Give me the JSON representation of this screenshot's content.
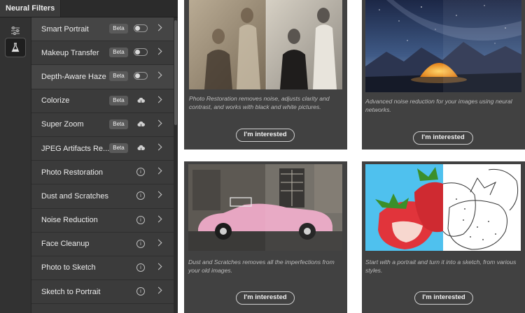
{
  "panel": {
    "title": "Neural Filters",
    "rail": [
      {
        "icon": "sliders-icon"
      },
      {
        "icon": "flask-icon"
      }
    ],
    "filters": [
      {
        "label": "Smart Portrait",
        "badge": "Beta",
        "control": "toggle",
        "selected": true
      },
      {
        "label": "Makeup Transfer",
        "badge": "Beta",
        "control": "toggle",
        "selected": false
      },
      {
        "label": "Depth-Aware Haze",
        "badge": "Beta",
        "control": "toggle",
        "selected": true
      },
      {
        "label": "Colorize",
        "badge": "Beta",
        "control": "cloud-download-icon",
        "selected": false
      },
      {
        "label": "Super Zoom",
        "badge": "Beta",
        "control": "cloud-download-icon",
        "selected": false
      },
      {
        "label": "JPEG Artifacts Re...",
        "badge": "Beta",
        "control": "cloud-download-icon",
        "selected": false
      },
      {
        "label": "Photo Restoration",
        "badge": "",
        "control": "info-icon",
        "selected": false
      },
      {
        "label": "Dust and Scratches",
        "badge": "",
        "control": "info-icon",
        "selected": false
      },
      {
        "label": "Noise Reduction",
        "badge": "",
        "control": "info-icon",
        "selected": false
      },
      {
        "label": "Face Cleanup",
        "badge": "",
        "control": "info-icon",
        "selected": false
      },
      {
        "label": "Photo to Sketch",
        "badge": "",
        "control": "info-icon",
        "selected": false
      },
      {
        "label": "Sketch to Portrait",
        "badge": "",
        "control": "info-icon",
        "selected": false
      }
    ]
  },
  "cards": {
    "photo_restoration": {
      "description": "Photo Restoration removes noise, adjusts clarity and contrast, and works with black and white pictures.",
      "button": "I'm interested"
    },
    "noise_reduction": {
      "description": "Advanced noise reduction for your images using neural networks.",
      "button": "I'm interested"
    },
    "dust_scratches": {
      "description": "Dust and Scratches removes all the imperfections from your old images.",
      "button": "I'm interested"
    },
    "photo_to_sketch": {
      "description": "Start with a portrait and turn it into a sketch, from various styles.",
      "button": "I'm interested"
    }
  },
  "colors": {
    "panel_bg": "#3b3b3b",
    "card_bg": "#414141",
    "text": "#ececec",
    "badge_bg": "#5a5a5a"
  }
}
